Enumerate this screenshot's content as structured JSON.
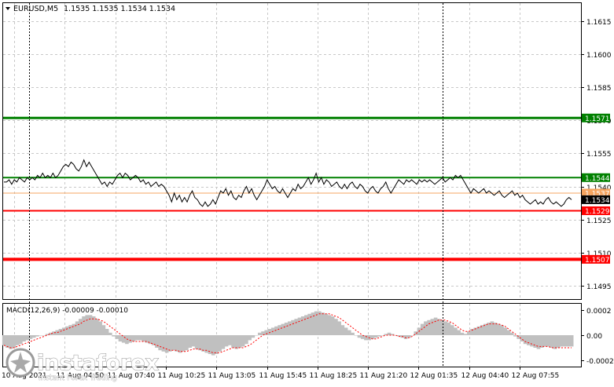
{
  "header": {
    "symbol": "EURUSD,M5",
    "ohlc": "1.1535 1.1535 1.1534 1.1534",
    "macd_label": "MACD(12,26,9) -0.00009 -0.00010"
  },
  "watermark": {
    "brand": "instaforex",
    "tagline": "Instant Forex Trading"
  },
  "colors": {
    "price_line": "#000000",
    "resistance": "#008000",
    "support": "#ff0000",
    "current_line": "#f4a460",
    "macd_hist": "#c0c0c0",
    "macd_signal": "#ff0000",
    "grid": "#c8c8c8"
  },
  "chart_data": [
    {
      "type": "line",
      "title": "EURUSD,M5",
      "ylim": [
        1.1489,
        1.1623
      ],
      "y_ticks": [
        "1.1615",
        "1.1600",
        "1.1585",
        "1.1570",
        "1.1555",
        "1.1540",
        "1.1525",
        "1.1510",
        "1.1495"
      ],
      "x_ticks": [
        "10 Aug 2021",
        "11 Aug 04:50",
        "11 Aug 07:40",
        "11 Aug 10:25",
        "11 Aug 13:05",
        "11 Aug 15:45",
        "11 Aug 18:25",
        "11 Aug 21:20",
        "12 Aug 01:35",
        "12 Aug 04:40",
        "12 Aug 07:55"
      ],
      "levels": [
        {
          "value": 1.1571,
          "label": "1.1571",
          "kind": "resistance",
          "width": 3
        },
        {
          "value": 1.1544,
          "label": "1.1544",
          "kind": "resistance",
          "width": 2
        },
        {
          "value": 1.1537,
          "label": "1.1537",
          "kind": "current",
          "width": 1
        },
        {
          "value": 1.1534,
          "label": "1.1534",
          "kind": "last",
          "width": 0
        },
        {
          "value": 1.1529,
          "label": "1.1529",
          "kind": "support",
          "width": 2
        },
        {
          "value": 1.1507,
          "label": "1.1507",
          "kind": "support",
          "width": 4
        }
      ],
      "series": [
        {
          "values": [
            1.1542,
            1.1542,
            1.1543,
            1.1541,
            1.1543,
            1.1542,
            1.1544,
            1.1543,
            1.1542,
            1.1544,
            1.1543,
            1.1544,
            1.1543,
            1.1545,
            1.1544,
            1.1546,
            1.1544,
            1.1545,
            1.1544,
            1.1546,
            1.1544,
            1.1545,
            1.1547,
            1.1549,
            1.155,
            1.1549,
            1.1551,
            1.155,
            1.1548,
            1.1547,
            1.1549,
            1.1552,
            1.1549,
            1.1551,
            1.1549,
            1.1547,
            1.1545,
            1.1543,
            1.1541,
            1.1542,
            1.154,
            1.1542,
            1.1541,
            1.1543,
            1.1545,
            1.1546,
            1.1544,
            1.1546,
            1.1545,
            1.1543,
            1.1544,
            1.1545,
            1.1544,
            1.1542,
            1.1543,
            1.1541,
            1.1542,
            1.154,
            1.1541,
            1.1542,
            1.154,
            1.1541,
            1.154,
            1.1538,
            1.1536,
            1.1533,
            1.1537,
            1.1534,
            1.1536,
            1.1533,
            1.1535,
            1.1533,
            1.1536,
            1.1538,
            1.1535,
            1.1534,
            1.1532,
            1.1531,
            1.1533,
            1.1531,
            1.1532,
            1.1534,
            1.1532,
            1.1535,
            1.1538,
            1.1537,
            1.1539,
            1.1536,
            1.1538,
            1.1535,
            1.1534,
            1.1536,
            1.1535,
            1.1538,
            1.154,
            1.1537,
            1.1539,
            1.1536,
            1.1534,
            1.1536,
            1.1538,
            1.154,
            1.1543,
            1.1541,
            1.1539,
            1.154,
            1.1538,
            1.1537,
            1.1539,
            1.1537,
            1.1535,
            1.1537,
            1.1539,
            1.1538,
            1.1541,
            1.1539,
            1.154,
            1.1542,
            1.1544,
            1.1541,
            1.1543,
            1.1546,
            1.1542,
            1.1544,
            1.1541,
            1.1543,
            1.1542,
            1.154,
            1.1541,
            1.1542,
            1.154,
            1.1539,
            1.1541,
            1.1539,
            1.1541,
            1.1542,
            1.154,
            1.1539,
            1.1541,
            1.154,
            1.1538,
            1.1537,
            1.1539,
            1.154,
            1.1538,
            1.1537,
            1.1539,
            1.154,
            1.1542,
            1.1539,
            1.1537,
            1.1539,
            1.1541,
            1.1543,
            1.1542,
            1.1541,
            1.1543,
            1.1542,
            1.1543,
            1.1542,
            1.1541,
            1.1543,
            1.1542,
            1.1543,
            1.1542,
            1.1543,
            1.1542,
            1.1541,
            1.1542,
            1.1543,
            1.1544,
            1.1542,
            1.1543,
            1.1544,
            1.1543,
            1.1545,
            1.1544,
            1.1545,
            1.1543,
            1.1541,
            1.1539,
            1.1537,
            1.1539,
            1.1538,
            1.1537,
            1.1538,
            1.1539,
            1.1537,
            1.1538,
            1.1537,
            1.1536,
            1.1537,
            1.1538,
            1.1536,
            1.1535,
            1.1536,
            1.1537,
            1.1538,
            1.1536,
            1.1537,
            1.1535,
            1.1536,
            1.1534,
            1.1533,
            1.1532,
            1.1533,
            1.1534,
            1.1532,
            1.1533,
            1.1532,
            1.1534,
            1.1535,
            1.1533,
            1.1532,
            1.1533,
            1.1532,
            1.1531,
            1.1532,
            1.1534,
            1.1535,
            1.1534
          ]
        }
      ]
    },
    {
      "type": "bar",
      "title": "MACD(12,26,9) -0.00009 -0.00010",
      "ylim": [
        -0.00025,
        0.00025
      ],
      "y_ticks": [
        "0.0002",
        "0.00",
        "-0.0002"
      ],
      "series": [
        {
          "name": "MACD",
          "kind": "histogram",
          "values": [
            -8e-05,
            -0.0001,
            -0.00011,
            -0.0001,
            -8e-05,
            -7e-05,
            -5e-05,
            -4e-05,
            -3e-05,
            -2e-05,
            -1e-05,
            0.0,
            0.0,
            1e-05,
            2e-05,
            3e-05,
            4e-05,
            5e-05,
            6e-05,
            7e-05,
            8e-05,
            9e-05,
            0.00011,
            0.00013,
            0.00015,
            0.00016,
            0.00016,
            0.00015,
            0.00013,
            0.00011,
            8e-05,
            5e-05,
            2e-05,
            -1e-05,
            -3e-05,
            -5e-05,
            -6e-05,
            -7e-05,
            -6e-05,
            -5e-05,
            -4e-05,
            -4e-05,
            -5e-05,
            -6e-05,
            -7e-05,
            -8e-05,
            -0.0001,
            -0.00012,
            -0.00013,
            -0.00014,
            -0.00013,
            -0.00012,
            -0.00013,
            -0.00014,
            -0.00013,
            -0.00012,
            -0.0001,
            -9e-05,
            -0.00011,
            -0.00012,
            -0.00013,
            -0.00014,
            -0.00015,
            -0.00016,
            -0.00015,
            -0.00013,
            -0.00011,
            -9e-05,
            -8e-05,
            -0.0001,
            -0.00011,
            -0.0001,
            -9e-05,
            -7e-05,
            -4e-05,
            -2e-05,
            0.0,
            2e-05,
            3e-05,
            4e-05,
            5e-05,
            6e-05,
            7e-05,
            8e-05,
            9e-05,
            0.0001,
            0.00011,
            0.00012,
            0.00013,
            0.00014,
            0.00015,
            0.00016,
            0.00017,
            0.00018,
            0.00019,
            0.00019,
            0.00018,
            0.00017,
            0.00016,
            0.00015,
            0.00013,
            0.00011,
            8e-05,
            6e-05,
            4e-05,
            2e-05,
            0.0,
            -2e-05,
            -3e-05,
            -4e-05,
            -4e-05,
            -3e-05,
            -2e-05,
            -1e-05,
            0.0,
            1e-05,
            2e-05,
            1e-05,
            0.0,
            -1e-05,
            -2e-05,
            -3e-05,
            -2e-05,
            0.0,
            3e-05,
            6e-05,
            9e-05,
            0.00011,
            0.00012,
            0.00013,
            0.00014,
            0.00013,
            0.00012,
            0.00011,
            0.0001,
            8e-05,
            6e-05,
            4e-05,
            2e-05,
            1e-05,
            3e-05,
            5e-05,
            6e-05,
            7e-05,
            8e-05,
            9e-05,
            0.0001,
            0.00011,
            0.0001,
            9e-05,
            8e-05,
            6e-05,
            4e-05,
            2e-05,
            -1e-05,
            -3e-05,
            -5e-05,
            -7e-05,
            -8e-05,
            -9e-05,
            -0.0001,
            -0.00011,
            -0.0001,
            -9e-05,
            -9e-05,
            -0.0001,
            -0.00011,
            -0.0001,
            -9e-05,
            -9e-05,
            -9e-05,
            -9e-05
          ]
        },
        {
          "name": "Signal",
          "kind": "dotted-line",
          "values": [
            -8e-05,
            -9e-05,
            -0.0001,
            -0.0001,
            -9e-05,
            -8e-05,
            -7e-05,
            -6e-05,
            -5e-05,
            -4e-05,
            -3e-05,
            -2e-05,
            -1e-05,
            0.0,
            1e-05,
            2e-05,
            2e-05,
            3e-05,
            4e-05,
            5e-05,
            6e-05,
            7e-05,
            8e-05,
            9e-05,
            0.00011,
            0.00012,
            0.00013,
            0.00013,
            0.00013,
            0.00012,
            0.00011,
            9e-05,
            7e-05,
            5e-05,
            3e-05,
            1e-05,
            -1e-05,
            -3e-05,
            -4e-05,
            -5e-05,
            -5e-05,
            -5e-05,
            -5e-05,
            -5e-05,
            -6e-05,
            -7e-05,
            -8e-05,
            -9e-05,
            -0.0001,
            -0.00011,
            -0.00012,
            -0.00012,
            -0.00012,
            -0.00013,
            -0.00013,
            -0.00013,
            -0.00012,
            -0.00011,
            -0.00011,
            -0.00011,
            -0.00012,
            -0.00012,
            -0.00013,
            -0.00014,
            -0.00014,
            -0.00014,
            -0.00013,
            -0.00012,
            -0.00011,
            -0.0001,
            -0.0001,
            -0.0001,
            -0.0001,
            -9e-05,
            -8e-05,
            -6e-05,
            -4e-05,
            -2e-05,
            0.0,
            1e-05,
            2e-05,
            3e-05,
            4e-05,
            5e-05,
            6e-05,
            7e-05,
            8e-05,
            9e-05,
            0.0001,
            0.00011,
            0.00012,
            0.00013,
            0.00014,
            0.00015,
            0.00016,
            0.00017,
            0.00017,
            0.00017,
            0.00017,
            0.00016,
            0.00015,
            0.00014,
            0.00012,
            0.0001,
            8e-05,
            6e-05,
            4e-05,
            2e-05,
            0.0,
            -1e-05,
            -2e-05,
            -3e-05,
            -3e-05,
            -2e-05,
            -1e-05,
            0.0,
            0.0,
            0.0,
            0.0,
            -1e-05,
            -1e-05,
            -2e-05,
            -2e-05,
            -1e-05,
            1e-05,
            3e-05,
            5e-05,
            7e-05,
            9e-05,
            0.0001,
            0.00011,
            0.00012,
            0.00012,
            0.00012,
            0.00011,
            0.0001,
            8e-05,
            6e-05,
            4e-05,
            3e-05,
            3e-05,
            4e-05,
            5e-05,
            6e-05,
            7e-05,
            8e-05,
            9e-05,
            9e-05,
            9e-05,
            9e-05,
            8e-05,
            7e-05,
            5e-05,
            3e-05,
            1e-05,
            -1e-05,
            -3e-05,
            -5e-05,
            -6e-05,
            -7e-05,
            -8e-05,
            -9e-05,
            -9e-05,
            -9e-05,
            -9e-05,
            -0.0001,
            -0.0001,
            -0.0001,
            -0.0001,
            -0.0001,
            -0.0001,
            -0.0001
          ]
        }
      ]
    }
  ]
}
